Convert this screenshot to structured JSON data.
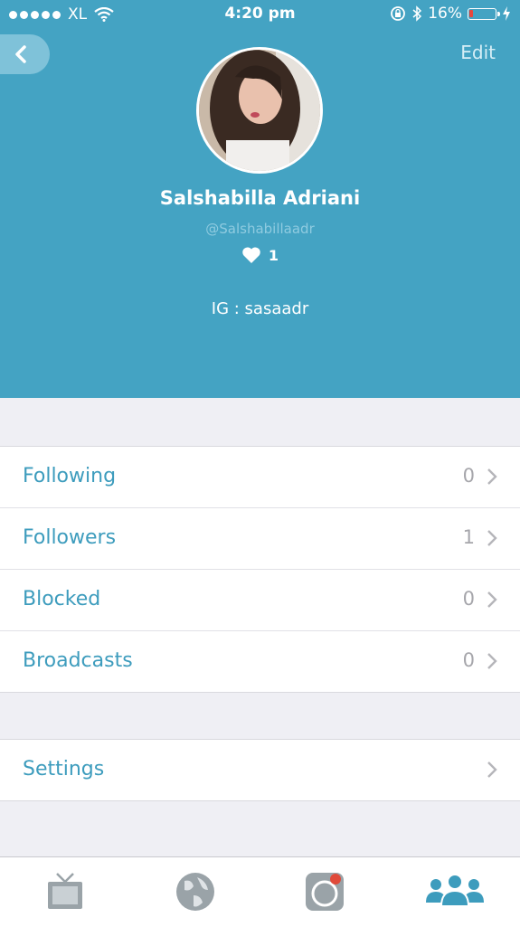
{
  "status_bar": {
    "carrier": "XL",
    "time": "4:20 pm",
    "battery": "16%",
    "battery_level": 0.16
  },
  "header": {
    "edit_label": "Edit"
  },
  "profile": {
    "name": "Salshabilla Adriani",
    "handle": "@Salshabillaadr",
    "likes": "1",
    "bio": "IG : sasaadr"
  },
  "rows": [
    {
      "label": "Following",
      "count": "0"
    },
    {
      "label": "Followers",
      "count": "1"
    },
    {
      "label": "Blocked",
      "count": "0"
    },
    {
      "label": "Broadcasts",
      "count": "0"
    }
  ],
  "settings": {
    "label": "Settings"
  },
  "tabs": [
    {
      "icon": "tv-icon"
    },
    {
      "icon": "globe-icon"
    },
    {
      "icon": "broadcast-icon"
    },
    {
      "icon": "people-icon",
      "active": true
    }
  ],
  "colors": {
    "header": "#44a3c3",
    "accent": "#3d9cbd",
    "muted": "#a6a6ab",
    "battery_low": "#e8473d"
  }
}
